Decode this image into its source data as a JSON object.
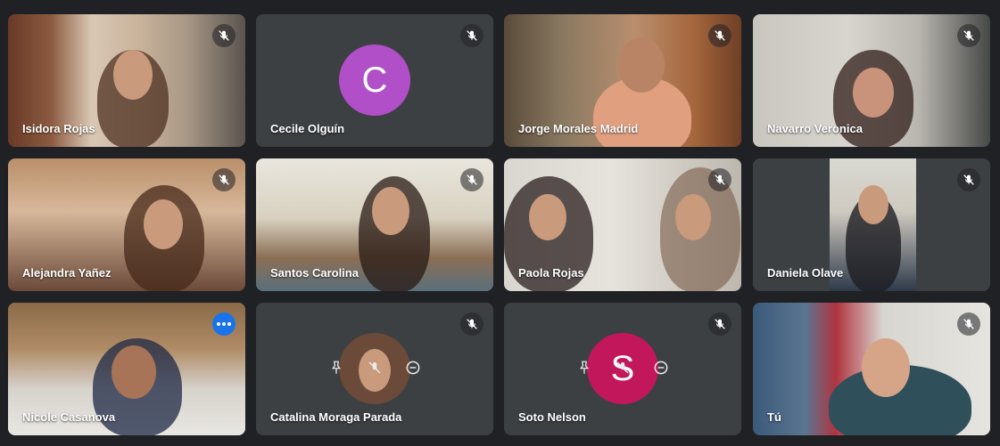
{
  "participants": [
    {
      "name": "Isidora Rojas",
      "muted": true
    },
    {
      "name": "Cecile Olguín",
      "muted": true,
      "avatar_letter": "C",
      "avatar_color": "#b04fc7"
    },
    {
      "name": "Jorge Morales Madrid",
      "muted": true
    },
    {
      "name": "Navarro Veronica",
      "muted": true
    },
    {
      "name": "Alejandra Yañez",
      "muted": true
    },
    {
      "name": "Santos Carolina",
      "muted": true
    },
    {
      "name": "Paola Rojas",
      "muted": true
    },
    {
      "name": "Daniela Olave",
      "muted": true
    },
    {
      "name": "Nicole Casanova",
      "muted": false,
      "active_speaker": true
    },
    {
      "name": "Catalina Moraga Parada",
      "muted": true
    },
    {
      "name": "Soto Nelson",
      "muted": true,
      "avatar_letter": "S",
      "avatar_color": "#c2185b"
    },
    {
      "name": "Tú",
      "muted": true
    }
  ],
  "colors": {
    "background": "#202124",
    "tile": "#3c4043",
    "accent": "#1a73e8",
    "active_border": "#8ab4f8"
  },
  "icons": {
    "mute": "mic-off-icon",
    "more": "more-options-icon",
    "pin": "pin-icon",
    "remove": "remove-icon"
  }
}
